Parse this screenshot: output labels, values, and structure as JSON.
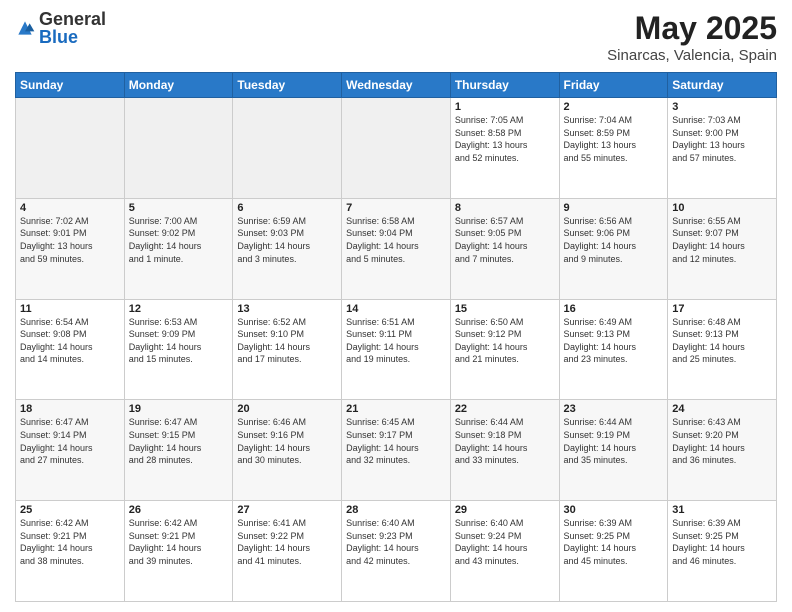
{
  "header": {
    "logo_general": "General",
    "logo_blue": "Blue",
    "month_year": "May 2025",
    "location": "Sinarcas, Valencia, Spain"
  },
  "days_of_week": [
    "Sunday",
    "Monday",
    "Tuesday",
    "Wednesday",
    "Thursday",
    "Friday",
    "Saturday"
  ],
  "weeks": [
    [
      {
        "day": "",
        "info": ""
      },
      {
        "day": "",
        "info": ""
      },
      {
        "day": "",
        "info": ""
      },
      {
        "day": "",
        "info": ""
      },
      {
        "day": "1",
        "info": "Sunrise: 7:05 AM\nSunset: 8:58 PM\nDaylight: 13 hours\nand 52 minutes."
      },
      {
        "day": "2",
        "info": "Sunrise: 7:04 AM\nSunset: 8:59 PM\nDaylight: 13 hours\nand 55 minutes."
      },
      {
        "day": "3",
        "info": "Sunrise: 7:03 AM\nSunset: 9:00 PM\nDaylight: 13 hours\nand 57 minutes."
      }
    ],
    [
      {
        "day": "4",
        "info": "Sunrise: 7:02 AM\nSunset: 9:01 PM\nDaylight: 13 hours\nand 59 minutes."
      },
      {
        "day": "5",
        "info": "Sunrise: 7:00 AM\nSunset: 9:02 PM\nDaylight: 14 hours\nand 1 minute."
      },
      {
        "day": "6",
        "info": "Sunrise: 6:59 AM\nSunset: 9:03 PM\nDaylight: 14 hours\nand 3 minutes."
      },
      {
        "day": "7",
        "info": "Sunrise: 6:58 AM\nSunset: 9:04 PM\nDaylight: 14 hours\nand 5 minutes."
      },
      {
        "day": "8",
        "info": "Sunrise: 6:57 AM\nSunset: 9:05 PM\nDaylight: 14 hours\nand 7 minutes."
      },
      {
        "day": "9",
        "info": "Sunrise: 6:56 AM\nSunset: 9:06 PM\nDaylight: 14 hours\nand 9 minutes."
      },
      {
        "day": "10",
        "info": "Sunrise: 6:55 AM\nSunset: 9:07 PM\nDaylight: 14 hours\nand 12 minutes."
      }
    ],
    [
      {
        "day": "11",
        "info": "Sunrise: 6:54 AM\nSunset: 9:08 PM\nDaylight: 14 hours\nand 14 minutes."
      },
      {
        "day": "12",
        "info": "Sunrise: 6:53 AM\nSunset: 9:09 PM\nDaylight: 14 hours\nand 15 minutes."
      },
      {
        "day": "13",
        "info": "Sunrise: 6:52 AM\nSunset: 9:10 PM\nDaylight: 14 hours\nand 17 minutes."
      },
      {
        "day": "14",
        "info": "Sunrise: 6:51 AM\nSunset: 9:11 PM\nDaylight: 14 hours\nand 19 minutes."
      },
      {
        "day": "15",
        "info": "Sunrise: 6:50 AM\nSunset: 9:12 PM\nDaylight: 14 hours\nand 21 minutes."
      },
      {
        "day": "16",
        "info": "Sunrise: 6:49 AM\nSunset: 9:13 PM\nDaylight: 14 hours\nand 23 minutes."
      },
      {
        "day": "17",
        "info": "Sunrise: 6:48 AM\nSunset: 9:13 PM\nDaylight: 14 hours\nand 25 minutes."
      }
    ],
    [
      {
        "day": "18",
        "info": "Sunrise: 6:47 AM\nSunset: 9:14 PM\nDaylight: 14 hours\nand 27 minutes."
      },
      {
        "day": "19",
        "info": "Sunrise: 6:47 AM\nSunset: 9:15 PM\nDaylight: 14 hours\nand 28 minutes."
      },
      {
        "day": "20",
        "info": "Sunrise: 6:46 AM\nSunset: 9:16 PM\nDaylight: 14 hours\nand 30 minutes."
      },
      {
        "day": "21",
        "info": "Sunrise: 6:45 AM\nSunset: 9:17 PM\nDaylight: 14 hours\nand 32 minutes."
      },
      {
        "day": "22",
        "info": "Sunrise: 6:44 AM\nSunset: 9:18 PM\nDaylight: 14 hours\nand 33 minutes."
      },
      {
        "day": "23",
        "info": "Sunrise: 6:44 AM\nSunset: 9:19 PM\nDaylight: 14 hours\nand 35 minutes."
      },
      {
        "day": "24",
        "info": "Sunrise: 6:43 AM\nSunset: 9:20 PM\nDaylight: 14 hours\nand 36 minutes."
      }
    ],
    [
      {
        "day": "25",
        "info": "Sunrise: 6:42 AM\nSunset: 9:21 PM\nDaylight: 14 hours\nand 38 minutes."
      },
      {
        "day": "26",
        "info": "Sunrise: 6:42 AM\nSunset: 9:21 PM\nDaylight: 14 hours\nand 39 minutes."
      },
      {
        "day": "27",
        "info": "Sunrise: 6:41 AM\nSunset: 9:22 PM\nDaylight: 14 hours\nand 41 minutes."
      },
      {
        "day": "28",
        "info": "Sunrise: 6:40 AM\nSunset: 9:23 PM\nDaylight: 14 hours\nand 42 minutes."
      },
      {
        "day": "29",
        "info": "Sunrise: 6:40 AM\nSunset: 9:24 PM\nDaylight: 14 hours\nand 43 minutes."
      },
      {
        "day": "30",
        "info": "Sunrise: 6:39 AM\nSunset: 9:25 PM\nDaylight: 14 hours\nand 45 minutes."
      },
      {
        "day": "31",
        "info": "Sunrise: 6:39 AM\nSunset: 9:25 PM\nDaylight: 14 hours\nand 46 minutes."
      }
    ]
  ]
}
